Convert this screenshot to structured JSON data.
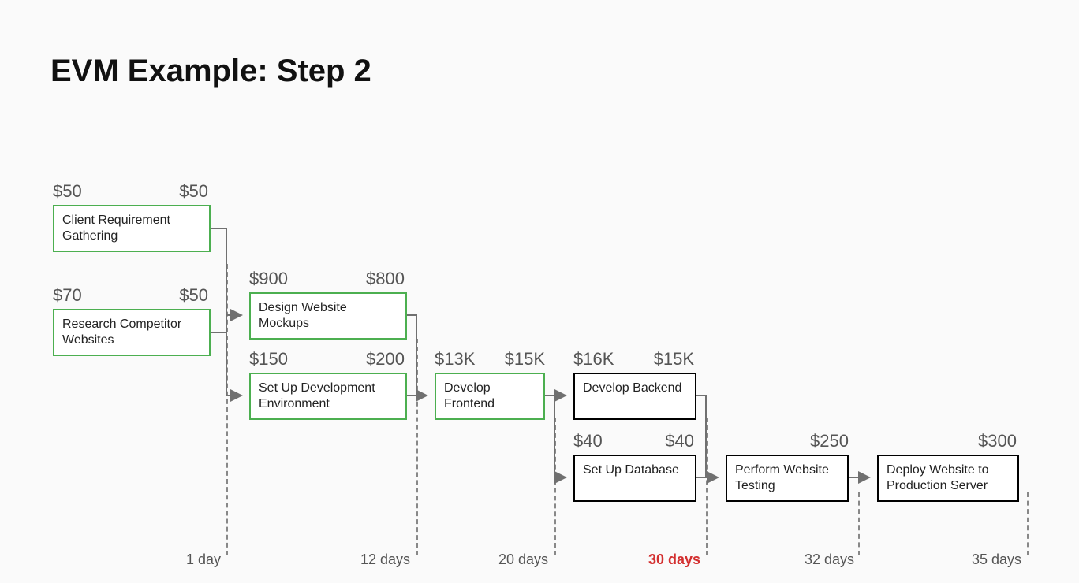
{
  "title": "EVM Example: Step 2",
  "chart_data": {
    "type": "diagram",
    "timeline_unit": "days",
    "milestones": [
      {
        "label": "1 day",
        "highlight": false
      },
      {
        "label": "12 days",
        "highlight": false
      },
      {
        "label": "20 days",
        "highlight": false
      },
      {
        "label": "30 days",
        "highlight": true
      },
      {
        "label": "32 days",
        "highlight": false
      },
      {
        "label": "35 days",
        "highlight": false
      }
    ],
    "tasks": [
      {
        "id": "t1",
        "label": "Client Requirement Gathering",
        "status": "complete",
        "cost_left": "$50",
        "cost_right": "$50"
      },
      {
        "id": "t2",
        "label": "Research Competitor Websites",
        "status": "complete",
        "cost_left": "$70",
        "cost_right": "$50"
      },
      {
        "id": "t3",
        "label": "Design Website Mockups",
        "status": "complete",
        "cost_left": "$900",
        "cost_right": "$800"
      },
      {
        "id": "t4",
        "label": "Set Up Development Environment",
        "status": "complete",
        "cost_left": "$150",
        "cost_right": "$200"
      },
      {
        "id": "t5",
        "label": "Develop Frontend",
        "status": "complete",
        "cost_left": "$13K",
        "cost_right": "$15K"
      },
      {
        "id": "t6",
        "label": "Develop Backend",
        "status": "pending",
        "cost_left": "$16K",
        "cost_right": "$15K"
      },
      {
        "id": "t7",
        "label": "Set Up Database",
        "status": "pending",
        "cost_left": "$40",
        "cost_right": "$40"
      },
      {
        "id": "t8",
        "label": "Perform Website Testing",
        "status": "pending",
        "cost_left": null,
        "cost_right": "$250"
      },
      {
        "id": "t9",
        "label": "Deploy Website to Production Server",
        "status": "pending",
        "cost_left": null,
        "cost_right": "$300"
      }
    ],
    "edges": [
      [
        "t1",
        "t3"
      ],
      [
        "t1",
        "t4"
      ],
      [
        "t2",
        "t3"
      ],
      [
        "t2",
        "t4"
      ],
      [
        "t3",
        "t5"
      ],
      [
        "t4",
        "t5"
      ],
      [
        "t5",
        "t6"
      ],
      [
        "t5",
        "t7"
      ],
      [
        "t6",
        "t8"
      ],
      [
        "t7",
        "t8"
      ],
      [
        "t8",
        "t9"
      ]
    ]
  }
}
